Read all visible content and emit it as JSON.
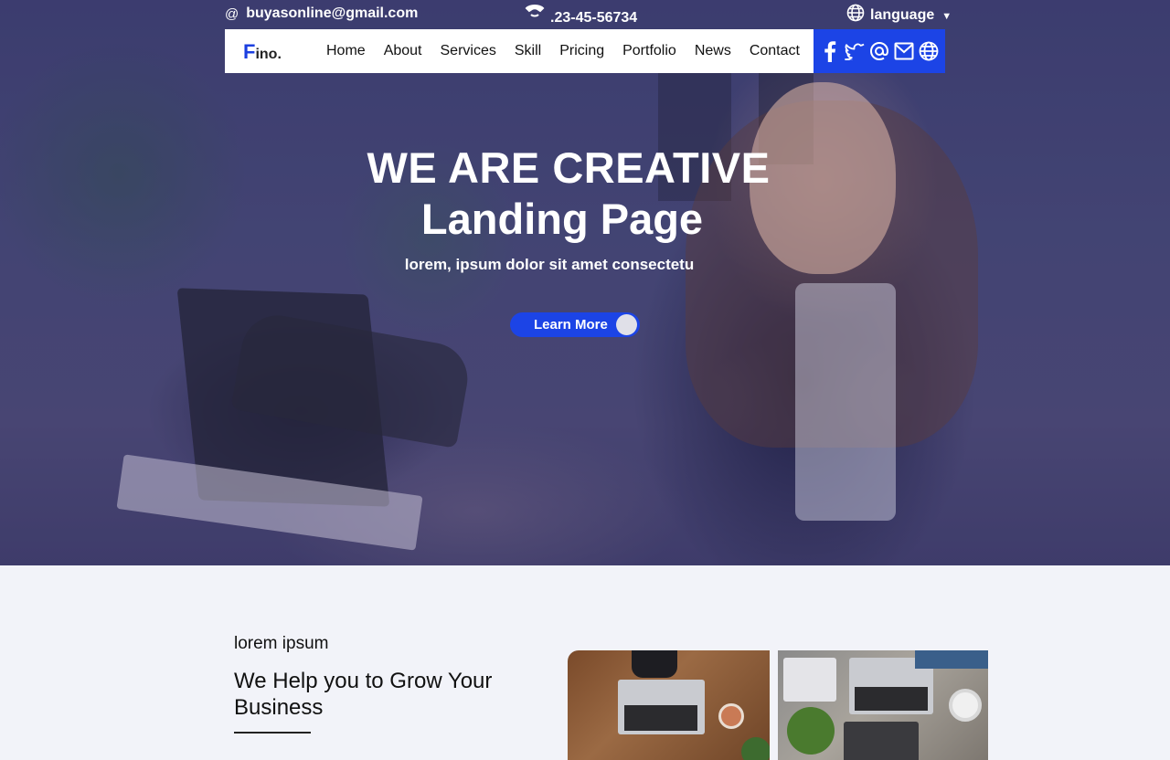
{
  "topbar": {
    "email_icon": "@",
    "email": "buyasonline@gmail.com",
    "phone": ".23-45-56734",
    "language": "language"
  },
  "nav": {
    "logo_big": "F",
    "logo_rest": "ino.",
    "links": [
      "Home",
      "About",
      "Services",
      "Skill",
      "Pricing",
      "Portfolio",
      "News",
      "Contact"
    ],
    "social_icons": [
      "facebook-icon",
      "twitter-icon",
      "at-icon",
      "mail-icon",
      "globe-icon"
    ]
  },
  "hero": {
    "title_line1": "WE ARE CREATIVE",
    "title_line2": "Landing Page",
    "subtitle": "lorem, ipsum dolor sit amet consectetu",
    "button_label": "Learn More"
  },
  "about": {
    "kicker": "lorem ipsum",
    "title": "We Help you to Grow Your Business"
  },
  "colors": {
    "accent": "#1c44e6",
    "section_bg": "#f2f3f9"
  }
}
